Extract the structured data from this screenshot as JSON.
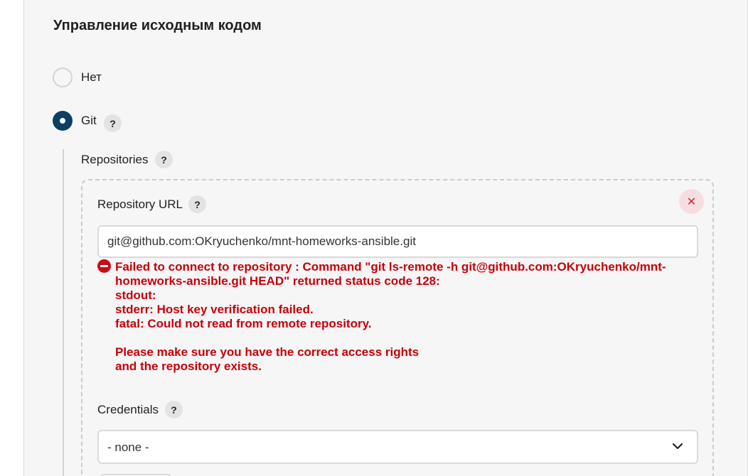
{
  "section": {
    "title": "Управление исходным кодом"
  },
  "scm_options": [
    {
      "label": "Нет",
      "selected": false
    },
    {
      "label": "Git",
      "selected": true
    }
  ],
  "help_icon_glyph": "?",
  "git": {
    "repositories_label": "Repositories",
    "repository": {
      "url_label": "Repository URL",
      "url_value": "git@github.com:OKryuchenko/mnt-homeworks-ansible.git",
      "delete_glyph": "✕",
      "error_message": "Failed to connect to repository : Command \"git ls-remote -h git@github.com:OKryuchenko/mnt-\nhomeworks-ansible.git HEAD\" returned status code 128:\nstdout:\nstderr: Host key verification failed.\nfatal: Could not read from remote repository.\n\nPlease make sure you have the correct access rights\nand the repository exists.",
      "credentials_label": "Credentials",
      "credentials_value": "- none -"
    }
  },
  "colors": {
    "radio_selected": "#0b3f63",
    "error": "#c70008",
    "delete_bg": "#f7dde1"
  },
  "icons": {
    "help": "question-mark-icon",
    "delete": "close-icon",
    "error": "error-icon",
    "dropdown": "chevron-down-icon"
  }
}
